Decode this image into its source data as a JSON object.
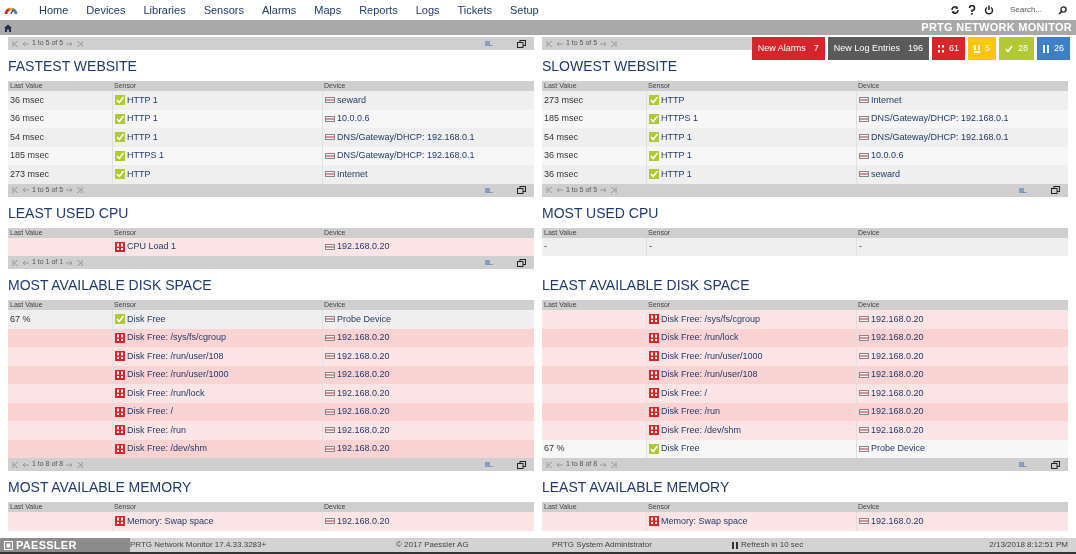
{
  "nav": {
    "items": [
      {
        "label": "Home"
      },
      {
        "label": "Devices"
      },
      {
        "label": "Libraries"
      },
      {
        "label": "Sensors"
      },
      {
        "label": "Alarms"
      },
      {
        "label": "Maps"
      },
      {
        "label": "Reports"
      },
      {
        "label": "Logs"
      },
      {
        "label": "Tickets"
      },
      {
        "label": "Setup"
      }
    ],
    "search": {
      "placeholder": "Search..."
    }
  },
  "header": {
    "title": "PRTG NETWORK MONITOR"
  },
  "top_pagers": [
    {
      "text": "1 to 5 of 5"
    },
    {
      "text": "1 to 5 of 5"
    }
  ],
  "badges": [
    {
      "kind": "text",
      "label": "New Alarms",
      "count": "7",
      "color": "#d7252b"
    },
    {
      "kind": "text",
      "label": "New Log Entries",
      "count": "196",
      "color": "#5a5a5a"
    },
    {
      "kind": "down",
      "count": "61",
      "color": "#d7252b"
    },
    {
      "kind": "warning",
      "count": "5",
      "color": "#fcc60d"
    },
    {
      "kind": "up",
      "count": "28",
      "color": "#b2c935"
    },
    {
      "kind": "paused",
      "count": "26",
      "color": "#3d80c6"
    }
  ],
  "sections": [
    {
      "title": "FASTEST WEBSITE",
      "columns": [
        "Last Value",
        "Sensor",
        "Device"
      ],
      "pager": "1 to 5 of 5",
      "rows": [
        {
          "kind": "sensor",
          "last_value": "36 msec",
          "alarm": false,
          "sensor": "HTTP 1",
          "device": "seward"
        },
        {
          "kind": "sensor",
          "last_value": "36 msec",
          "alarm": false,
          "sensor": "HTTP 1",
          "device": "10.0.0.6"
        },
        {
          "kind": "sensor",
          "last_value": "54 msec",
          "alarm": false,
          "sensor": "HTTP 1",
          "device": "DNS/Gateway/DHCP: 192.168.0.1"
        },
        {
          "kind": "sensor",
          "last_value": "185 msec",
          "alarm": false,
          "sensor": "HTTPS 1",
          "device": "DNS/Gateway/DHCP: 192.168.0.1"
        },
        {
          "kind": "sensor",
          "last_value": "273 msec",
          "alarm": false,
          "sensor": "HTTP",
          "device": "Internet"
        }
      ]
    },
    {
      "title": "SLOWEST WEBSITE",
      "columns": [
        "Last Value",
        "Sensor",
        "Device"
      ],
      "pager": "1 to 5 of 5",
      "rows": [
        {
          "kind": "sensor",
          "last_value": "273 msec",
          "alarm": false,
          "sensor": "HTTP",
          "device": "Internet"
        },
        {
          "kind": "sensor",
          "last_value": "185 msec",
          "alarm": false,
          "sensor": "HTTPS 1",
          "device": "DNS/Gateway/DHCP: 192.168.0.1"
        },
        {
          "kind": "sensor",
          "last_value": "54 msec",
          "alarm": false,
          "sensor": "HTTP 1",
          "device": "DNS/Gateway/DHCP: 192.168.0.1"
        },
        {
          "kind": "sensor",
          "last_value": "36 msec",
          "alarm": false,
          "sensor": "HTTP 1",
          "device": "10.0.0.6"
        },
        {
          "kind": "sensor",
          "last_value": "36 msec",
          "alarm": false,
          "sensor": "HTTP 1",
          "device": "seward"
        }
      ]
    },
    {
      "title": "LEAST USED CPU",
      "columns": [
        "Last Value",
        "Sensor",
        "Device"
      ],
      "pager": "1 to 1 of 1",
      "rows": [
        {
          "kind": "sensor",
          "alarm": true,
          "sensor": "CPU Load 1",
          "device": "192.168.0.20"
        }
      ]
    },
    {
      "title": "MOST USED CPU",
      "columns": [
        "Last Value",
        "Sensor",
        "Device"
      ],
      "rows": [
        {
          "kind": "empty",
          "last_value": "-",
          "sensor": "-",
          "device": "-"
        }
      ]
    },
    {
      "title": "MOST AVAILABLE DISK SPACE",
      "columns": [
        "Last Value",
        "Sensor",
        "Device"
      ],
      "pager": "1 to 8 of 8",
      "rows": [
        {
          "kind": "sensor",
          "last_value": "67 %",
          "alarm": false,
          "sensor": "Disk Free",
          "device": "Probe Device"
        },
        {
          "kind": "sensor",
          "alarm": true,
          "sensor": "Disk Free: /sys/fs/cgroup",
          "device": "192.168.0.20"
        },
        {
          "kind": "sensor",
          "alarm": true,
          "sensor": "Disk Free: /run/user/108",
          "device": "192.168.0.20"
        },
        {
          "kind": "sensor",
          "alarm": true,
          "sensor": "Disk Free: /run/user/1000",
          "device": "192.168.0.20"
        },
        {
          "kind": "sensor",
          "alarm": true,
          "sensor": "Disk Free: /run/lock",
          "device": "192.168.0.20"
        },
        {
          "kind": "sensor",
          "alarm": true,
          "sensor": "Disk Free: /",
          "device": "192.168.0.20"
        },
        {
          "kind": "sensor",
          "alarm": true,
          "sensor": "Disk Free: /run",
          "device": "192.168.0.20"
        },
        {
          "kind": "sensor",
          "alarm": true,
          "sensor": "Disk Free: /dev/shm",
          "device": "192.168.0.20"
        }
      ]
    },
    {
      "title": "LEAST AVAILABLE DISK SPACE",
      "columns": [
        "Last Value",
        "Sensor",
        "Device"
      ],
      "pager": "1 to 8 of 8",
      "rows": [
        {
          "kind": "sensor",
          "alarm": true,
          "sensor": "Disk Free: /sys/fs/cgroup",
          "device": "192.168.0.20"
        },
        {
          "kind": "sensor",
          "alarm": true,
          "sensor": "Disk Free: /run/lock",
          "device": "192.168.0.20"
        },
        {
          "kind": "sensor",
          "alarm": true,
          "sensor": "Disk Free: /run/user/1000",
          "device": "192.168.0.20"
        },
        {
          "kind": "sensor",
          "alarm": true,
          "sensor": "Disk Free: /run/user/108",
          "device": "192.168.0.20"
        },
        {
          "kind": "sensor",
          "alarm": true,
          "sensor": "Disk Free: /",
          "device": "192.168.0.20"
        },
        {
          "kind": "sensor",
          "alarm": true,
          "sensor": "Disk Free: /run",
          "device": "192.168.0.20"
        },
        {
          "kind": "sensor",
          "alarm": true,
          "sensor": "Disk Free: /dev/shm",
          "device": "192.168.0.20"
        },
        {
          "kind": "sensor",
          "last_value": "67 %",
          "alarm": false,
          "sensor": "Disk Free",
          "device": "Probe Device"
        }
      ]
    },
    {
      "title": "MOST AVAILABLE MEMORY",
      "columns": [
        "Last Value",
        "Sensor",
        "Device"
      ],
      "rows": [
        {
          "kind": "sensor",
          "alarm": true,
          "sensor": "Memory: Swap space",
          "device": "192.168.0.20"
        }
      ]
    },
    {
      "title": "LEAST AVAILABLE MEMORY",
      "columns": [
        "Last Value",
        "Sensor",
        "Device"
      ],
      "rows": [
        {
          "kind": "sensor",
          "alarm": true,
          "sensor": "Memory: Swap space",
          "device": "192.168.0.20"
        }
      ]
    }
  ],
  "footer": {
    "brand": "PAESSLER",
    "version": "PRTG Network Monitor 17.4.33.3283+",
    "copyright": "© 2017 Paessler AG",
    "user": "PRTG System Administrator",
    "refresh": "Refresh in 10 sec",
    "datetime": "2/13/2018 8:12:51 PM"
  }
}
